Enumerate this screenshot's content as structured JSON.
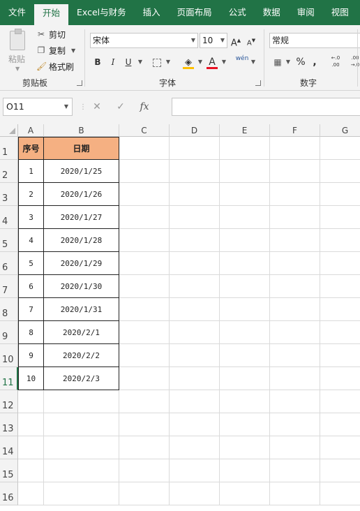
{
  "tabs": [
    "文件",
    "开始",
    "Excel与财务",
    "插入",
    "页面布局",
    "公式",
    "数据",
    "审阅",
    "视图"
  ],
  "active_tab": "开始",
  "clipboard": {
    "paste": "粘贴",
    "cut": "剪切",
    "copy": "复制",
    "format_painter": "格式刷",
    "group": "剪贴板"
  },
  "font": {
    "name": "宋体",
    "size": "10",
    "grow": "A",
    "shrink": "A",
    "bold": "B",
    "italic": "I",
    "underline": "U",
    "font_color": "A",
    "phonetic": "wén",
    "group": "字体"
  },
  "number": {
    "format": "常规",
    "percent": "%",
    "comma": ",",
    "inc_decimal": "←.0 .00",
    "dec_decimal": ".00 →.0",
    "group": "数字"
  },
  "formula_bar": {
    "name_box": "O11",
    "cancel": "✕",
    "enter": "✓",
    "fx": "fx",
    "value": ""
  },
  "columns": [
    "A",
    "B",
    "C",
    "D",
    "E",
    "F",
    "G"
  ],
  "rows": [
    "1",
    "2",
    "3",
    "4",
    "5",
    "6",
    "7",
    "8",
    "9",
    "10",
    "11",
    "12",
    "13",
    "14",
    "15",
    "16"
  ],
  "selected_row": "11",
  "table": {
    "header": [
      "序号",
      "日期"
    ],
    "rows": [
      [
        "1",
        "2020/1/25"
      ],
      [
        "2",
        "2020/1/26"
      ],
      [
        "3",
        "2020/1/27"
      ],
      [
        "4",
        "2020/1/28"
      ],
      [
        "5",
        "2020/1/29"
      ],
      [
        "6",
        "2020/1/30"
      ],
      [
        "7",
        "2020/1/31"
      ],
      [
        "8",
        "2020/2/1"
      ],
      [
        "9",
        "2020/2/2"
      ],
      [
        "10",
        "2020/2/3"
      ]
    ]
  },
  "colors": {
    "brand": "#217346",
    "header_fill": "#f5b082",
    "font_color_bar": "#e81123",
    "fill_color_bar": "#ffc000"
  }
}
